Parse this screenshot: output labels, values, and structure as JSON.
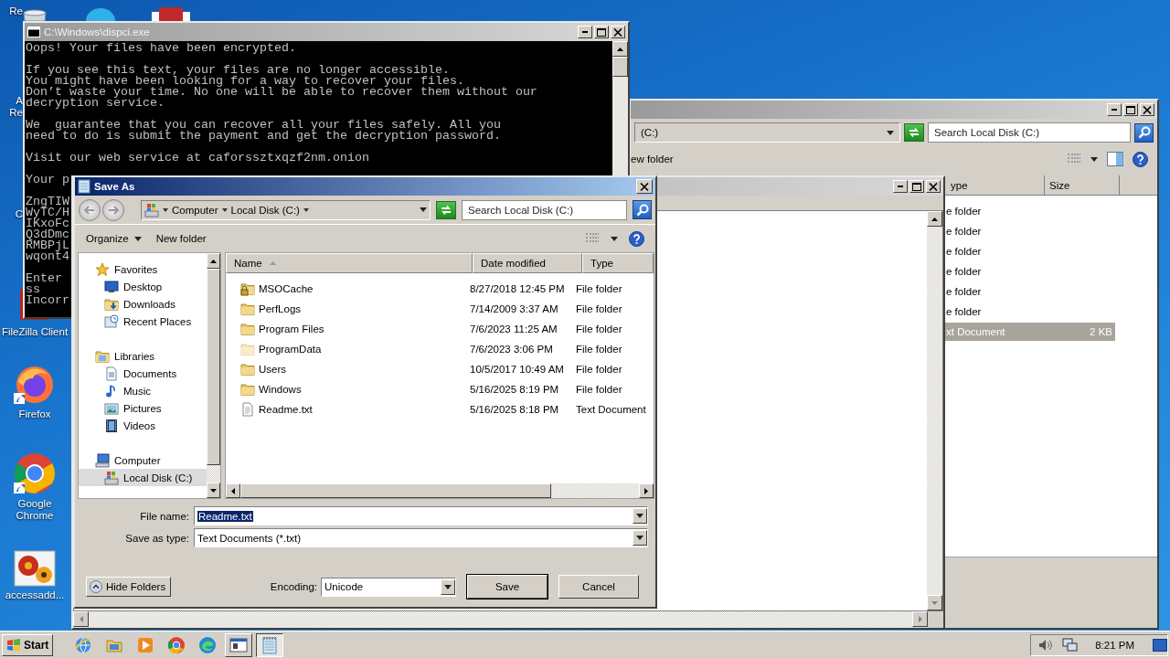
{
  "desktop_icons": [
    {
      "label_lines": [
        "Re"
      ],
      "kind": "partial"
    },
    {
      "label_lines": [
        "A",
        "Re"
      ],
      "kind": "partial"
    },
    {
      "label_lines": [
        "C"
      ],
      "kind": "partial"
    },
    {
      "label_lines": [
        "FileZilla Client"
      ],
      "kind": "full"
    },
    {
      "label_lines": [
        "Firefox"
      ],
      "kind": "full"
    },
    {
      "label_lines": [
        "Google",
        "Chrome"
      ],
      "kind": "full"
    },
    {
      "label_lines": [
        "accessadd..."
      ],
      "kind": "full"
    }
  ],
  "console": {
    "title": "C:\\Windows\\dispci.exe",
    "paragraphs": [
      [
        "Oops! Your files have been encrypted."
      ],
      [
        "If you see this text, your files are no longer accessible.",
        "You might have been looking for a way to recover your files.",
        "Don’t waste your time. No one will be able to recover them without our",
        "decryption service."
      ],
      [
        "We  guarantee that you can recover all your files safely. All you",
        "need to do is submit the payment and get the decryption password."
      ],
      [
        "Visit our web service at caforssztxqzf2nm.onion"
      ],
      [
        "Your p"
      ],
      [
        "ZngTIW",
        "WyTC/H",
        "IKxoFc",
        "Q3dDmc",
        "RMBPjL",
        "wqont4"
      ],
      [
        "Enter",
        "ss",
        "Incorr"
      ]
    ]
  },
  "explorer": {
    "address": "(C:)",
    "search_placeholder": "Search Local Disk (C:)",
    "new_folder": "ew folder",
    "columns": [
      "ype",
      "Size"
    ],
    "rows": [
      {
        "type": "e folder",
        "selected": false
      },
      {
        "type": "e folder",
        "selected": false
      },
      {
        "type": "e folder",
        "selected": false
      },
      {
        "type": "e folder",
        "selected": false
      },
      {
        "type": "e folder",
        "selected": false
      },
      {
        "type": "e folder",
        "selected": false
      },
      {
        "type": "xt Document",
        "size": "2 KB",
        "selected": true
      }
    ]
  },
  "save_dialog": {
    "title": "Save As",
    "breadcrumbs": [
      "Computer",
      "Local Disk (C:)"
    ],
    "search_placeholder": "Search Local Disk (C:)",
    "organize": "Organize",
    "new_folder": "New folder",
    "nav": [
      {
        "label": "Favorites",
        "selected": false,
        "children": [
          {
            "label": "Desktop",
            "selected": false
          },
          {
            "label": "Downloads",
            "selected": false
          },
          {
            "label": "Recent Places",
            "selected": false
          }
        ]
      },
      {
        "label": "Libraries",
        "selected": false,
        "children": [
          {
            "label": "Documents",
            "selected": false
          },
          {
            "label": "Music",
            "selected": false
          },
          {
            "label": "Pictures",
            "selected": false
          },
          {
            "label": "Videos",
            "selected": false
          }
        ]
      },
      {
        "label": "Computer",
        "selected": false,
        "children": [
          {
            "label": "Local Disk (C:)",
            "selected": true
          }
        ]
      }
    ],
    "columns": [
      {
        "label": "Name",
        "sorted": true
      },
      {
        "label": "Date modified",
        "sorted": false
      },
      {
        "label": "Type",
        "sorted": false
      }
    ],
    "rows": [
      {
        "name": "MSOCache",
        "date": "8/27/2018 12:45 PM",
        "type": "File folder",
        "kind": "locked-folder"
      },
      {
        "name": "PerfLogs",
        "date": "7/14/2009 3:37 AM",
        "type": "File folder",
        "kind": "folder"
      },
      {
        "name": "Program Files",
        "date": "7/6/2023 11:25 AM",
        "type": "File folder",
        "kind": "folder"
      },
      {
        "name": "ProgramData",
        "date": "7/6/2023 3:06 PM",
        "type": "File folder",
        "kind": "hidden-folder"
      },
      {
        "name": "Users",
        "date": "10/5/2017 10:49 AM",
        "type": "File folder",
        "kind": "folder"
      },
      {
        "name": "Windows",
        "date": "5/16/2025 8:19 PM",
        "type": "File folder",
        "kind": "folder"
      },
      {
        "name": "Readme.txt",
        "date": "5/16/2025 8:18 PM",
        "type": "Text Document",
        "kind": "text-file"
      }
    ],
    "file_name": {
      "label": "File name:",
      "value": "Readme.txt",
      "selected": true
    },
    "save_as_type": {
      "label": "Save as type:",
      "value": "Text Documents (*.txt)"
    },
    "hide_folders": "Hide Folders",
    "encoding": {
      "label": "Encoding:",
      "value": "Unicode"
    },
    "buttons": [
      {
        "label": "Save",
        "default": true
      },
      {
        "label": "Cancel",
        "default": false
      }
    ]
  },
  "taskbar": {
    "start": "Start",
    "apps": [
      {
        "kind": "launcher",
        "active": false
      },
      {
        "kind": "launcher",
        "active": false
      },
      {
        "kind": "launcher",
        "active": false
      },
      {
        "kind": "launcher",
        "active": false
      },
      {
        "kind": "launcher",
        "active": false
      },
      {
        "kind": "task",
        "active": false
      },
      {
        "kind": "task",
        "active": true
      }
    ],
    "clock": "8:21 PM"
  }
}
